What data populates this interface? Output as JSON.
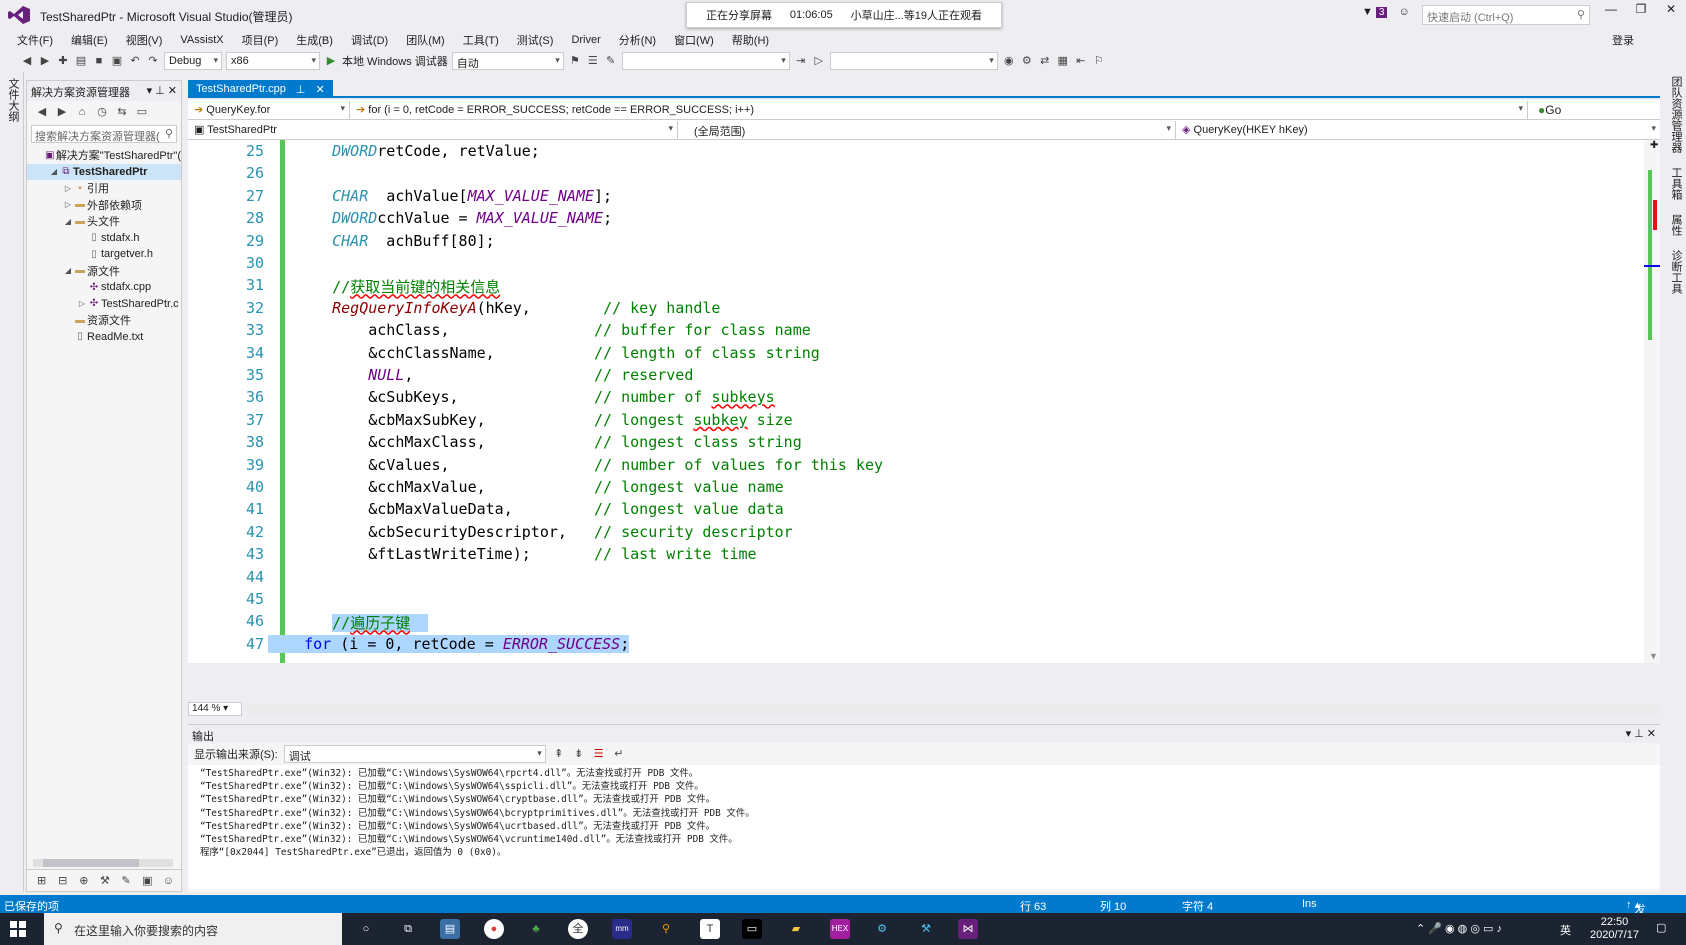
{
  "window": {
    "title": "TestSharedPtr - Microsoft Visual Studio(管理员)",
    "login": "登录",
    "quick_launch_placeholder": "快速启动 (Ctrl+Q)",
    "filter_count": "3"
  },
  "share_banner": {
    "status": "正在分享屏幕",
    "time": "01:06:05",
    "viewers": "小草山庄...等19人正在观看"
  },
  "menu": [
    "文件(F)",
    "编辑(E)",
    "视图(V)",
    "VAssistX",
    "项目(P)",
    "生成(B)",
    "调试(D)",
    "团队(M)",
    "工具(T)",
    "测试(S)",
    "Driver",
    "分析(N)",
    "窗口(W)",
    "帮助(H)"
  ],
  "toolbar": {
    "config": "Debug",
    "platform": "x86",
    "debugger": "本地 Windows 调试器",
    "auto": "自动"
  },
  "left_strip_label": "文件大纲",
  "right_strip_labels": [
    "团队资源管理器",
    "工具箱",
    "属性",
    "诊断工具"
  ],
  "solution": {
    "header": "解决方案资源管理器",
    "search_placeholder": "搜索解决方案资源管理器(",
    "tree": [
      {
        "label": "解决方案\"TestSharedPtr\"(",
        "level": 0,
        "arrow": "",
        "icon": "solution-icon"
      },
      {
        "label": "TestSharedPtr",
        "level": 1,
        "arrow": "◢",
        "icon": "project-icon",
        "bold": true
      },
      {
        "label": "引用",
        "level": 2,
        "arrow": "▷",
        "icon": "references-icon"
      },
      {
        "label": "外部依赖项",
        "level": 2,
        "arrow": "▷",
        "icon": "folder-icon"
      },
      {
        "label": "头文件",
        "level": 2,
        "arrow": "◢",
        "icon": "folder-icon"
      },
      {
        "label": "stdafx.h",
        "level": 3,
        "arrow": "",
        "icon": "file-icon"
      },
      {
        "label": "targetver.h",
        "level": 3,
        "arrow": "",
        "icon": "file-icon"
      },
      {
        "label": "源文件",
        "level": 2,
        "arrow": "◢",
        "icon": "folder-icon"
      },
      {
        "label": "stdafx.cpp",
        "level": 3,
        "arrow": "",
        "icon": "cpp-file-icon"
      },
      {
        "label": "TestSharedPtr.c",
        "level": 3,
        "arrow": "▷",
        "icon": "cpp-file-icon"
      },
      {
        "label": "资源文件",
        "level": 2,
        "arrow": "",
        "icon": "folder-icon"
      },
      {
        "label": "ReadMe.txt",
        "level": 2,
        "arrow": "",
        "icon": "file-icon"
      }
    ]
  },
  "editor": {
    "tab": "TestSharedPtr.cpp",
    "nav_scope": "QueryKey.for",
    "nav_statement": "for (i = 0, retCode = ERROR_SUCCESS; retCode == ERROR_SUCCESS; i++)",
    "go": "Go",
    "project": "TestSharedPtr",
    "global_scope": "(全局范围)",
    "function": "QueryKey(HKEY hKey)",
    "zoom": "144 %",
    "lines": [
      {
        "n": "25",
        "segs": [
          [
            "ty",
            "DWORD"
          ],
          [
            "",
            "retCode, retValue;"
          ]
        ],
        "indent": "    "
      },
      {
        "n": "26",
        "segs": [],
        "indent": ""
      },
      {
        "n": "27",
        "segs": [
          [
            "ty",
            "CHAR"
          ],
          [
            "",
            "  achValue["
          ],
          [
            "mc",
            "MAX_VALUE_NAME"
          ],
          [
            "",
            "];"
          ]
        ],
        "indent": "    "
      },
      {
        "n": "28",
        "segs": [
          [
            "ty",
            "DWORD"
          ],
          [
            "",
            "cchValue = "
          ],
          [
            "mc",
            "MAX_VALUE_NAME"
          ],
          [
            "",
            ";"
          ]
        ],
        "indent": "    "
      },
      {
        "n": "29",
        "segs": [
          [
            "ty",
            "CHAR"
          ],
          [
            "",
            "  achBuff[80];"
          ]
        ],
        "indent": "    "
      },
      {
        "n": "30",
        "segs": [],
        "indent": ""
      },
      {
        "n": "31",
        "segs": [
          [
            "cm",
            "//"
          ],
          [
            "cm squig",
            "获取当前键的相关信息"
          ]
        ],
        "indent": "    "
      },
      {
        "n": "32",
        "segs": [
          [
            "fn",
            "RegQueryInfoKeyA"
          ],
          [
            "",
            "(hKey,        "
          ],
          [
            "cm",
            "// key handle"
          ]
        ],
        "indent": "    "
      },
      {
        "n": "33",
        "segs": [
          [
            "",
            "achClass,                "
          ],
          [
            "cm",
            "// buffer for class name"
          ]
        ],
        "indent": "        "
      },
      {
        "n": "34",
        "segs": [
          [
            "",
            "&cchClassName,           "
          ],
          [
            "cm",
            "// length of class string"
          ]
        ],
        "indent": "        "
      },
      {
        "n": "35",
        "segs": [
          [
            "mc",
            "NULL"
          ],
          [
            "",
            ",                    "
          ],
          [
            "cm",
            "// reserved"
          ]
        ],
        "indent": "        "
      },
      {
        "n": "36",
        "segs": [
          [
            "",
            "&cSubKeys,               "
          ],
          [
            "cm",
            "// number of "
          ],
          [
            "cm squig",
            "subkeys"
          ]
        ],
        "indent": "        "
      },
      {
        "n": "37",
        "segs": [
          [
            "",
            "&cbMaxSubKey,            "
          ],
          [
            "cm",
            "// longest "
          ],
          [
            "cm squig",
            "subkey"
          ],
          [
            "cm",
            " size"
          ]
        ],
        "indent": "        "
      },
      {
        "n": "38",
        "segs": [
          [
            "",
            "&cchMaxClass,            "
          ],
          [
            "cm",
            "// longest class string"
          ]
        ],
        "indent": "        "
      },
      {
        "n": "39",
        "segs": [
          [
            "",
            "&cValues,                "
          ],
          [
            "cm",
            "// number of values for this key"
          ]
        ],
        "indent": "        "
      },
      {
        "n": "40",
        "segs": [
          [
            "",
            "&cchMaxValue,            "
          ],
          [
            "cm",
            "// longest value name"
          ]
        ],
        "indent": "        "
      },
      {
        "n": "41",
        "segs": [
          [
            "",
            "&cbMaxValueData,         "
          ],
          [
            "cm",
            "// longest value data"
          ]
        ],
        "indent": "        "
      },
      {
        "n": "42",
        "segs": [
          [
            "",
            "&cbSecurityDescriptor,   "
          ],
          [
            "cm",
            "// security descriptor"
          ]
        ],
        "indent": "        "
      },
      {
        "n": "43",
        "segs": [
          [
            "",
            "&ftLastWriteTime);       "
          ],
          [
            "cm",
            "// last write time"
          ]
        ],
        "indent": "        "
      },
      {
        "n": "44",
        "segs": [],
        "indent": ""
      },
      {
        "n": "45",
        "segs": [],
        "indent": ""
      },
      {
        "n": "46",
        "segs": [
          [
            "cm hl",
            "//"
          ],
          [
            "cm squig hl",
            "遍历子键"
          ],
          [
            "hl",
            "  "
          ]
        ],
        "indent": "    "
      },
      {
        "n": "47",
        "segs": [
          [
            "kw hl",
            "for"
          ],
          [
            "hl",
            " (i = 0, retCode = "
          ],
          [
            "mc hl",
            "ERROR_SUCCESS"
          ],
          [
            "hl",
            ";"
          ]
        ],
        "indent": "    "
      }
    ]
  },
  "output": {
    "header": "输出",
    "source_label": "显示输出来源(S):",
    "source_value": "调试",
    "lines": [
      "“TestSharedPtr.exe”(Win32): 已加载“C:\\Windows\\SysWOW64\\rpcrt4.dll”。无法查找或打开 PDB 文件。",
      "“TestSharedPtr.exe”(Win32): 已加载“C:\\Windows\\SysWOW64\\sspicli.dll”。无法查找或打开 PDB 文件。",
      "“TestSharedPtr.exe”(Win32): 已加载“C:\\Windows\\SysWOW64\\cryptbase.dll”。无法查找或打开 PDB 文件。",
      "“TestSharedPtr.exe”(Win32): 已加载“C:\\Windows\\SysWOW64\\bcryptprimitives.dll”。无法查找或打开 PDB 文件。",
      "“TestSharedPtr.exe”(Win32): 已加载“C:\\Windows\\SysWOW64\\ucrtbased.dll”。无法查找或打开 PDB 文件。",
      "“TestSharedPtr.exe”(Win32): 已加载“C:\\Windows\\SysWOW64\\vcruntime140d.dll”。无法查找或打开 PDB 文件。",
      "程序“[0x2044] TestSharedPtr.exe”已退出，返回值为 0 (0x0)。"
    ]
  },
  "status": {
    "message": "已保存的项",
    "line": "行 63",
    "col": "列 10",
    "char": "字符 4",
    "mode": "Ins",
    "publish": "发布"
  },
  "taskbar": {
    "search_placeholder": "在这里输入你要搜索的内容",
    "ime": "英",
    "time": "22:50",
    "date": "2020/7/17"
  },
  "colors": {
    "accent": "#007acc",
    "vs_purple": "#68217a",
    "comment": "#008000",
    "keyword": "#0000ff",
    "selection": "#add6ff"
  }
}
